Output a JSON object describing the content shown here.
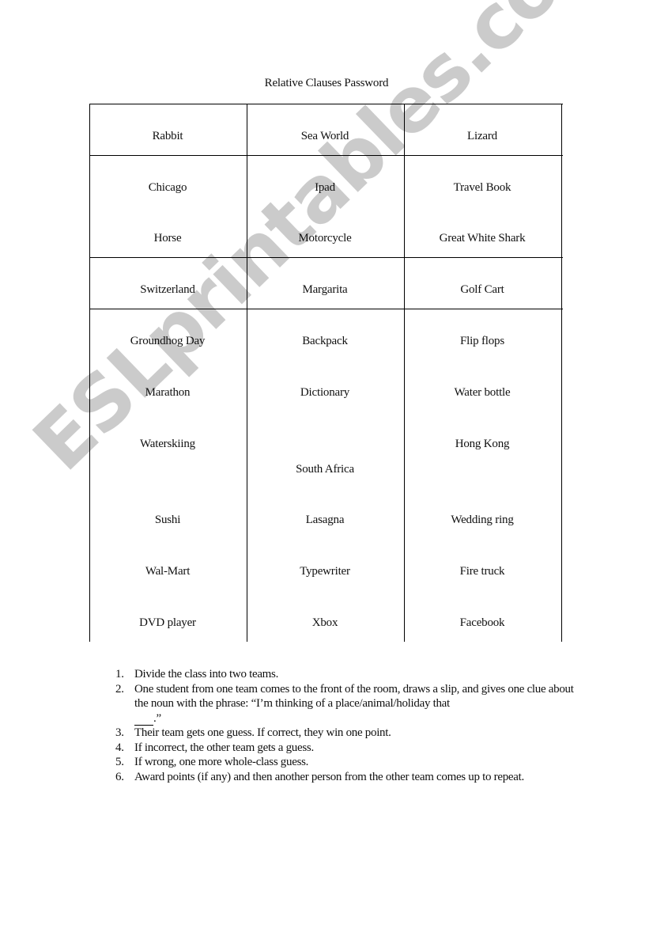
{
  "document": {
    "title": "Relative Clauses Password",
    "table": {
      "rows": [
        [
          "Rabbit",
          "Sea World",
          "Lizard"
        ],
        [
          "Chicago",
          "Ipad",
          "Travel Book"
        ],
        [
          "Horse",
          "Motorcycle",
          "Great White Shark"
        ],
        [
          "Switzerland",
          "Margarita",
          "Golf Cart"
        ],
        [
          "Groundhog Day",
          "Backpack",
          "Flip flops"
        ],
        [
          "Marathon",
          "Dictionary",
          "Water bottle"
        ],
        [
          "Waterskiing",
          "South Africa",
          "Hong Kong"
        ],
        [
          "Sushi",
          "Lasagna",
          "Wedding ring"
        ],
        [
          "Wal-Mart",
          "Typewriter",
          "Fire truck"
        ],
        [
          "DVD player",
          "Xbox",
          "Facebook"
        ]
      ]
    },
    "instructions": [
      {
        "num": "1.",
        "text": "Divide the class into two teams."
      },
      {
        "num": "2.",
        "text": "One student from one team comes to the front of the room, draws a slip, and gives one clue about the noun with the phrase: “I’m thinking of a place/animal/holiday that",
        "tail": ".”"
      },
      {
        "num": "3.",
        "text": "Their team gets one guess. If correct, they win one point."
      },
      {
        "num": "4.",
        "text": "If incorrect, the other team gets a guess."
      },
      {
        "num": "5.",
        "text": "If wrong, one more whole-class guess."
      },
      {
        "num": "6.",
        "text": "Award points (if any) and then another person from the other team comes up to repeat."
      }
    ]
  },
  "watermark": {
    "text": "ESLprintables.com",
    "color": "#c8c8c8"
  }
}
